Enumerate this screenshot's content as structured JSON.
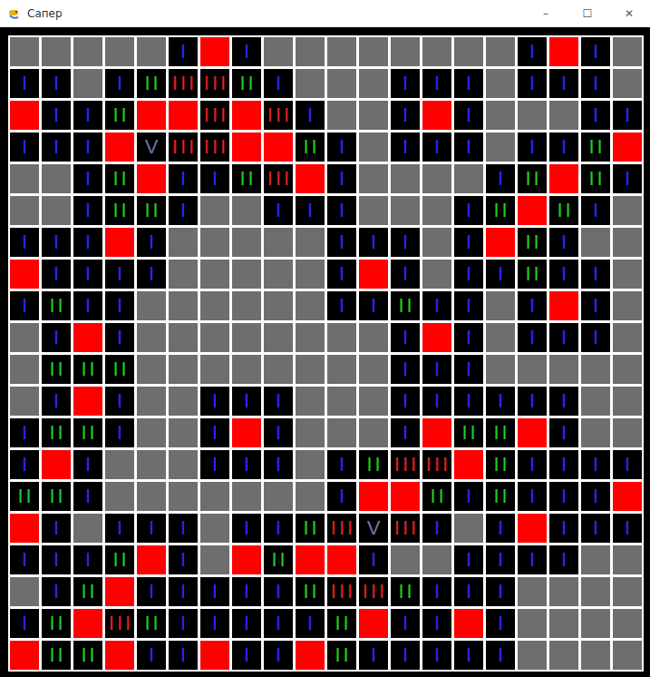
{
  "window": {
    "title": "Сапер",
    "controls": [
      "–",
      "☐",
      "✕"
    ]
  },
  "board": {
    "rows": [
      [
        "",
        "",
        "",
        "",
        "",
        "I",
        "*",
        "I",
        "",
        "",
        "",
        "",
        "",
        "",
        "",
        "",
        "I",
        "*",
        "I",
        ""
      ],
      [
        "I",
        "I",
        "",
        "I",
        "II",
        "III",
        "III",
        "II",
        "I",
        "",
        "",
        "",
        "I",
        "I",
        "I",
        "",
        "I",
        "I",
        "I",
        ""
      ],
      [
        "*",
        "I",
        "I",
        "II",
        "*",
        "*",
        "III",
        "*",
        "III",
        "I",
        "",
        "",
        "I",
        "*",
        "I",
        "",
        "",
        "",
        "I",
        "I"
      ],
      [
        "I",
        "I",
        "I",
        "*",
        "V",
        "III",
        "III",
        "*",
        "*",
        "II",
        "I",
        "",
        "I",
        "I",
        "I",
        "",
        "I",
        "I",
        "II",
        "*"
      ],
      [
        "",
        "",
        "I",
        "II",
        "*",
        "I",
        "I",
        "II",
        "III",
        "*",
        "I",
        "",
        "",
        "",
        "",
        "I",
        "II",
        "*",
        "II",
        "I"
      ],
      [
        "",
        "",
        "I",
        "II",
        "II",
        "I",
        "",
        "",
        "I",
        "I",
        "I",
        "",
        "",
        "",
        "I",
        "II",
        "*",
        "II",
        "I",
        ""
      ],
      [
        "I",
        "I",
        "I",
        "*",
        "I",
        "",
        "",
        "",
        "",
        "",
        "I",
        "I",
        "I",
        "",
        "I",
        "*",
        "II",
        "I",
        "",
        ""
      ],
      [
        "*",
        "I",
        "I",
        "I",
        "I",
        "",
        "",
        "",
        "",
        "",
        "I",
        "*",
        "I",
        "",
        "I",
        "I",
        "II",
        "I",
        "I",
        ""
      ],
      [
        "I",
        "II",
        "I",
        "I",
        "",
        "",
        "",
        "",
        "",
        "",
        "I",
        "I",
        "II",
        "I",
        "I",
        "",
        "I",
        "*",
        "I",
        ""
      ],
      [
        "",
        "I",
        "*",
        "I",
        "",
        "",
        "",
        "",
        "",
        "",
        "",
        "",
        "I",
        "*",
        "I",
        "",
        "I",
        "I",
        "I",
        ""
      ],
      [
        "",
        "II",
        "II",
        "II",
        "",
        "",
        "",
        "",
        "",
        "",
        "",
        "",
        "I",
        "I",
        "I",
        "",
        "",
        "",
        "",
        ""
      ],
      [
        "",
        "I",
        "*",
        "I",
        "",
        "",
        "I",
        "I",
        "I",
        "",
        "",
        "",
        "I",
        "I",
        "I",
        "I",
        "I",
        "I",
        "",
        ""
      ],
      [
        "I",
        "II",
        "II",
        "I",
        "",
        "",
        "I",
        "*",
        "I",
        "",
        "",
        "",
        "I",
        "*",
        "II",
        "II",
        "*",
        "I",
        "",
        ""
      ],
      [
        "I",
        "*",
        "I",
        "",
        "",
        "",
        "I",
        "I",
        "I",
        "",
        "I",
        "II",
        "III",
        "III",
        "*",
        "II",
        "I",
        "I",
        "I",
        "I"
      ],
      [
        "II",
        "II",
        "I",
        "",
        "",
        "",
        "",
        "",
        "",
        "",
        "I",
        "*",
        "*",
        "II",
        "I",
        "II",
        "I",
        "I",
        "I",
        "*"
      ],
      [
        "*",
        "I",
        "",
        "I",
        "I",
        "I",
        "",
        "I",
        "I",
        "II",
        "III",
        "V",
        "III",
        "I",
        "",
        "I",
        "*",
        "I",
        "I",
        "I"
      ],
      [
        "I",
        "I",
        "I",
        "II",
        "*",
        "I",
        "",
        "*",
        "II",
        "*",
        "*",
        "I",
        "",
        "",
        "I",
        "I",
        "I",
        "I",
        "",
        ""
      ],
      [
        "",
        "I",
        "II",
        "*",
        "I",
        "I",
        "I",
        "I",
        "I",
        "II",
        "III",
        "III",
        "II",
        "I",
        "I",
        "I",
        "",
        "",
        "",
        ""
      ],
      [
        "I",
        "II",
        "*",
        "III",
        "II",
        "I",
        "I",
        "I",
        "I",
        "I",
        "II",
        "*",
        "I",
        "I",
        "*",
        "I",
        "",
        "",
        "",
        ""
      ],
      [
        "*",
        "II",
        "II",
        "*",
        "I",
        "I",
        "*",
        "I",
        "I",
        "*",
        "II",
        "I",
        "I",
        "I",
        "I",
        "I",
        "",
        "",
        "",
        ""
      ]
    ]
  }
}
